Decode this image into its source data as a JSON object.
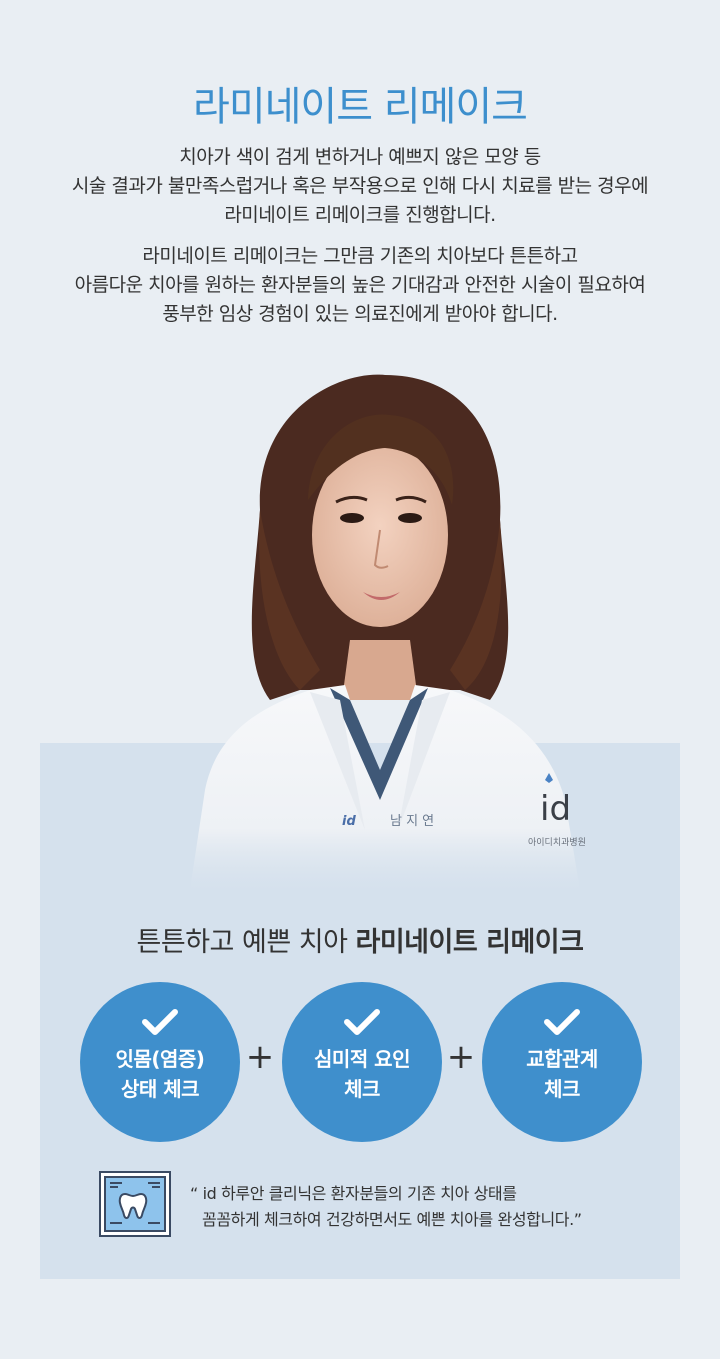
{
  "header": {
    "title": "라미네이트 리메이크",
    "para1": [
      "치아가 색이 검게 변하거나 예쁘지 않은 모양 등",
      "시술 결과가 불만족스럽거나 혹은 부작용으로 인해 다시 치료를 받는 경우에",
      "라미네이트 리메이크를 진행합니다."
    ],
    "para2": [
      "라미네이트 리메이크는 그만큼 기존의 치아보다 튼튼하고",
      "아름다운 치아를 원하는 환자분들의 높은 기대감과 안전한 시술이 필요하여",
      "풍부한 임상 경험이 있는 의료진에게 받아야 합니다."
    ]
  },
  "doctor": {
    "badge_logo": "id",
    "badge_name": "남 지 연",
    "sleeve_logo": "id",
    "sleeve_text": "아이디치과병원"
  },
  "checks": {
    "heading_normal": "튼튼하고 예쁜 치아 ",
    "heading_strong": "라미네이트 리메이크",
    "items": [
      {
        "line1": "잇몸(염증)",
        "line2": "상태 체크"
      },
      {
        "line1": "심미적 요인",
        "line2": "체크"
      },
      {
        "line1": "교합관계",
        "line2": "체크"
      }
    ],
    "plus": "+",
    "circle_color": "#3f8fcc"
  },
  "quote": {
    "line1": "“ id 하루안 클리닉은 환자분들의 기존 치아 상태를",
    "line2": "꼼꼼하게 체크하여 건강하면서도 예쁜 치아를 완성합니다.”",
    "icon": "tooth-xray-icon"
  },
  "colors": {
    "accent": "#3d8fcd",
    "panel": "#d5e1ed",
    "background": "#e9eef3"
  }
}
